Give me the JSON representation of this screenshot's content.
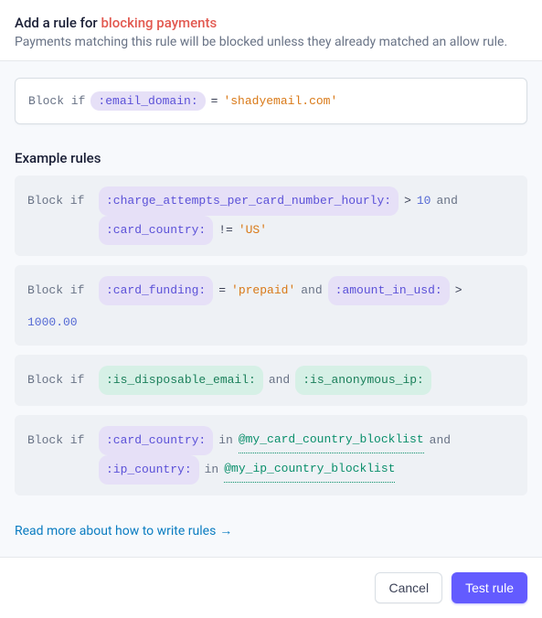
{
  "header": {
    "title_prefix": "Add a rule for ",
    "title_accent": "blocking payments",
    "subtitle": "Payments matching this rule will be blocked unless they already matched an allow rule."
  },
  "rule_input": {
    "prefix": "Block if",
    "field": ":email_domain:",
    "op": "=",
    "value": "'shadyemail.com'"
  },
  "examples_heading": "Example rules",
  "examples": {
    "ex1": {
      "prefix": "Block if",
      "field1": ":charge_attempts_per_card_number_hourly:",
      "op1": ">",
      "num1": "10",
      "kw_and": "and",
      "field2": ":card_country:",
      "op2": "!=",
      "str2": "'US'"
    },
    "ex2": {
      "prefix": "Block if",
      "field1": ":card_funding:",
      "op1": "=",
      "str1": "'prepaid'",
      "kw_and": "and",
      "field2": ":amount_in_usd:",
      "op2": ">",
      "num2": "1000.00"
    },
    "ex3": {
      "prefix": "Block if",
      "bool1": ":is_disposable_email:",
      "kw_and": "and",
      "bool2": ":is_anonymous_ip:"
    },
    "ex4": {
      "prefix": "Block if",
      "field1": ":card_country:",
      "kw_in1": "in",
      "ref1": "@my_card_country_blocklist",
      "kw_and": "and",
      "field2": ":ip_country:",
      "kw_in2": "in",
      "ref2": "@my_ip_country_blocklist"
    }
  },
  "link_text": "Read more about how to write rules",
  "footer": {
    "cancel": "Cancel",
    "test": "Test rule"
  }
}
